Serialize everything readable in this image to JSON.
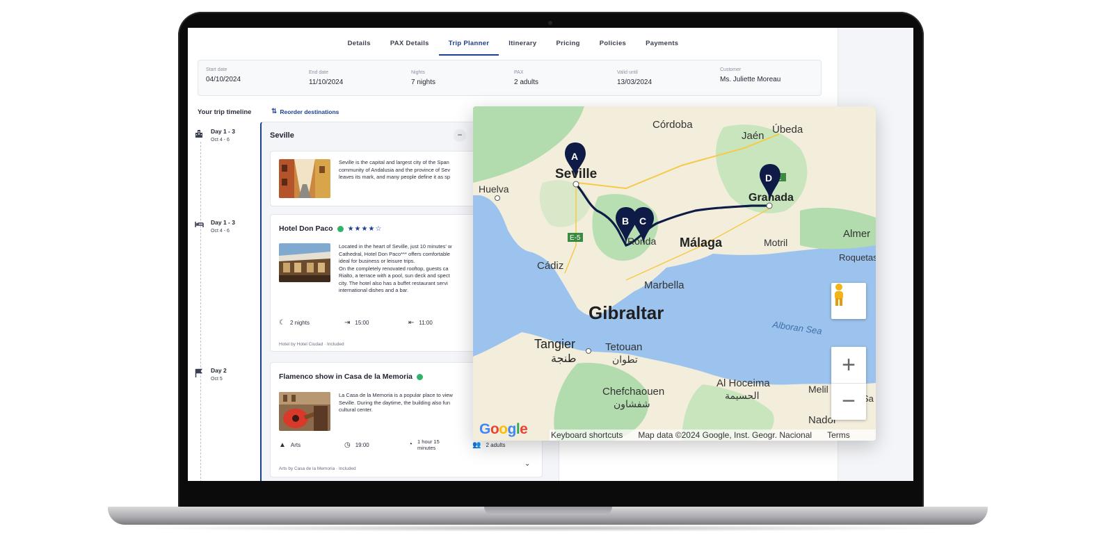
{
  "tabs": [
    {
      "label": "Details",
      "active": false
    },
    {
      "label": "PAX Details",
      "active": false
    },
    {
      "label": "Trip Planner",
      "active": true
    },
    {
      "label": "Itinerary",
      "active": false
    },
    {
      "label": "Pricing",
      "active": false
    },
    {
      "label": "Policies",
      "active": false
    },
    {
      "label": "Payments",
      "active": false
    }
  ],
  "summary": {
    "start_label": "Start date",
    "start_value": "04/10/2024",
    "end_label": "End date",
    "end_value": "11/10/2024",
    "nights_label": "Nights",
    "nights_value": "7 nights",
    "pax_label": "PAX",
    "pax_value": "2 adults",
    "valid_label": "Valid until",
    "valid_value": "13/03/2024",
    "customer_label": "Customer",
    "customer_value": "Ms. Juliette Moreau"
  },
  "timeline": {
    "title": "Your trip timeline",
    "reorder_label": "Reorder destinations",
    "days": [
      {
        "range": "Day 1 - 3",
        "dates": "Oct 4 - 6",
        "icon": "city-icon"
      },
      {
        "range": "Day 1 - 3",
        "dates": "Oct 4 - 6",
        "icon": "bed-icon"
      },
      {
        "range": "Day 2",
        "dates": "Oct 5",
        "icon": "flag-icon"
      }
    ]
  },
  "destination": {
    "name": "Seville",
    "collapse_symbol": "−",
    "intro": "Seville is the capital and largest city of the Span\ncommunity of Andalusia and the province of Sev\nleaves its mark, and many people define it as sp"
  },
  "hotel": {
    "name": "Hotel Don Paco",
    "stars": "★★★★☆",
    "rating": 4,
    "description": "Located in the heart of Seville, just 10 minutes' w\nCathedral, Hotel Don Paco*** offers comfortable\nideal for business or leisure trips.\nOn the completely renovated rooftop, guests ca\nRialto, a terrace with a pool, sun deck and spect\ncity. The hotel also has a buffet restaurant servi\ninternational dishes and a bar.",
    "nights": "2 nights",
    "checkin": "15:00",
    "checkout": "11:00",
    "provider": "Hotel by Hotel Ciudad",
    "included": "Included"
  },
  "activity": {
    "name": "Flamenco show in Casa de la Memoria",
    "description": "La Casa de la Memoria is a popular place to view\nSeville. During the daytime, the building also fun\ncultural center.",
    "category": "Arts",
    "time": "19:00",
    "duration": "1 hour 15\nminutes",
    "pax": "2 adults",
    "provider": "Arts by Casa de la Memoria",
    "included": "Included"
  },
  "map": {
    "labels": {
      "cordoba": "Córdoba",
      "jaen": "Jaén",
      "ubeda": "Úbeda",
      "seville": "Seville",
      "huelva": "Huelva",
      "granada": "Granada",
      "malaga": "Málaga",
      "motril": "Motril",
      "almeria": "Almer",
      "roquetas": "Roquetas\nde Mar",
      "cadiz": "Cádiz",
      "marbella": "Marbella",
      "gibraltar": "Gibraltar",
      "alboran": "Alboran Sea",
      "tangier": "Tangier",
      "tangier_ar": "طنجة",
      "tetouan": "Tetouan",
      "tetouan_ar": "تطوان",
      "chefchaouen": "Chefchaouen",
      "chefchaouen_ar": "شفشاون",
      "alhoceima": "Al Hoceima",
      "alhoceima_ar": "الحسيمة",
      "melilla": "Melil",
      "melilla_ar": "Sa",
      "nador": "Nador",
      "ronda": "Ronda",
      "e5": "E-5",
      "e902": "E"
    },
    "markers": [
      "A",
      "B",
      "C",
      "D"
    ],
    "footer": {
      "keyboard": "Keyboard shortcuts",
      "mapdata": "Map data ©2024 Google, Inst. Geogr. Nacional",
      "terms": "Terms"
    },
    "logo": "Google",
    "zoom_in": "+",
    "zoom_out": "−",
    "colors": {
      "water": "#9cc3ee",
      "land": "#f4efe0",
      "green": "#a8d9a5",
      "route": "#0f1b47"
    }
  }
}
